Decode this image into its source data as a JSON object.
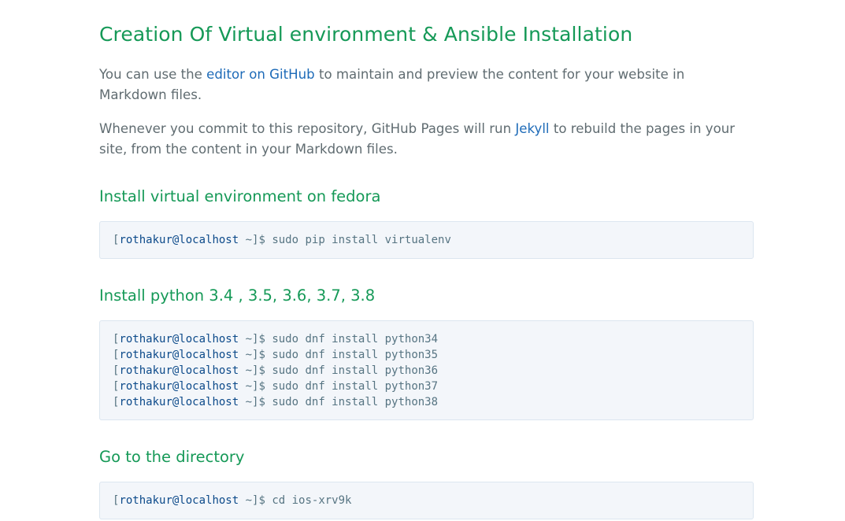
{
  "title": "Creation Of Virtual environment & Ansible Installation",
  "intro": {
    "p1_before": "You can use the ",
    "p1_link": "editor on GitHub",
    "p1_after": " to maintain and preview the content for your website in Markdown files.",
    "p2_before": "Whenever you commit to this repository, GitHub Pages will run ",
    "p2_link": "Jekyll",
    "p2_after": " to rebuild the pages in your site, from the content in your Markdown files."
  },
  "sections": [
    {
      "heading": "Install virtual environment on fedora",
      "lines": [
        {
          "open": "[",
          "user": "rothakur@localhost",
          "path": " ~",
          "close": "]$ ",
          "cmd": "sudo pip install virtualenv"
        }
      ]
    },
    {
      "heading": "Install python 3.4 , 3.5, 3.6, 3.7, 3.8",
      "lines": [
        {
          "open": "[",
          "user": "rothakur@localhost",
          "path": " ~",
          "close": "]$ ",
          "cmd": "sudo dnf install python34"
        },
        {
          "open": "[",
          "user": "rothakur@localhost",
          "path": " ~",
          "close": "]$ ",
          "cmd": "sudo dnf install python35"
        },
        {
          "open": "[",
          "user": "rothakur@localhost",
          "path": " ~",
          "close": "]$ ",
          "cmd": "sudo dnf install python36"
        },
        {
          "open": "[",
          "user": "rothakur@localhost",
          "path": " ~",
          "close": "]$ ",
          "cmd": "sudo dnf install python37"
        },
        {
          "open": "[",
          "user": "rothakur@localhost",
          "path": " ~",
          "close": "]$ ",
          "cmd": "sudo dnf install python38"
        }
      ]
    },
    {
      "heading": "Go to the directory",
      "lines": [
        {
          "open": "[",
          "user": "rothakur@localhost",
          "path": " ~",
          "close": "]$ ",
          "cmd": "cd ios-xrv9k"
        }
      ]
    }
  ],
  "colors": {
    "heading": "#159957",
    "link": "#1e6bb8",
    "text": "#606c71",
    "code_bg": "#f3f6fa",
    "code_user": "#0c4a8a"
  }
}
